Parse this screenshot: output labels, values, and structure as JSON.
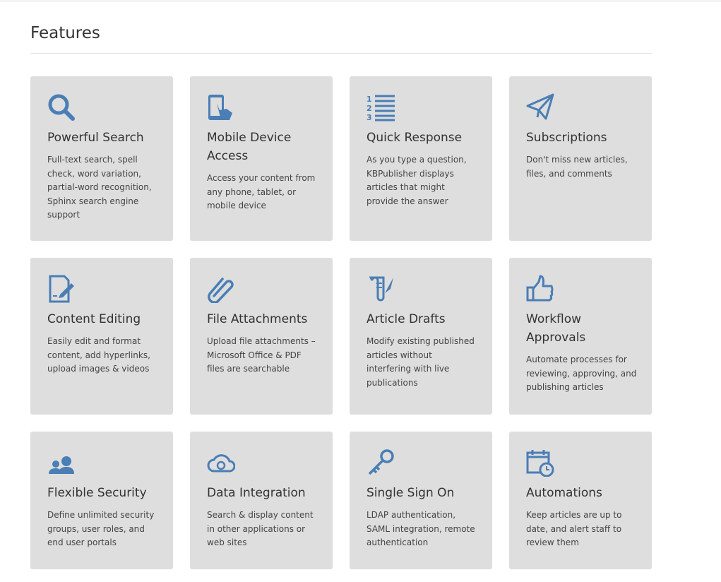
{
  "page": {
    "title": "Features",
    "accent": "#4a7eb5"
  },
  "features": [
    {
      "icon": "search-icon",
      "title": "Powerful Search",
      "desc": "Full-text search, spell check, word variation, partial-word recognition, Sphinx search engine support"
    },
    {
      "icon": "mobile-touch-icon",
      "title": "Mobile Device Access",
      "desc": "Access your content from any phone, tablet, or mobile device"
    },
    {
      "icon": "numbered-list-icon",
      "title": "Quick Response",
      "desc": "As you type a question, KBPublisher displays articles that might provide the answer"
    },
    {
      "icon": "paper-plane-icon",
      "title": "Subscriptions",
      "desc": "Don't miss new articles, files, and comments"
    },
    {
      "icon": "edit-document-icon",
      "title": "Content Editing",
      "desc": "Easily edit and format content, add hyperlinks, upload images & videos"
    },
    {
      "icon": "paperclip-icon",
      "title": "File Attachments",
      "desc": "Upload file attachments – Microsoft Office & PDF files are searchable"
    },
    {
      "icon": "scroll-quill-icon",
      "title": "Article Drafts",
      "desc": "Modify existing published articles without interfering with live publications"
    },
    {
      "icon": "thumbs-up-icon",
      "title": "Workflow Approvals",
      "desc": "Automate processes for reviewing, approving, and publishing articles"
    },
    {
      "icon": "users-icon",
      "title": "Flexible Security",
      "desc": "Define unlimited security groups, user roles, and end user portals"
    },
    {
      "icon": "cloud-sync-icon",
      "title": "Data Integration",
      "desc": "Search & display content in other applications or web sites"
    },
    {
      "icon": "key-icon",
      "title": "Single Sign On",
      "desc": "LDAP authentication, SAML integration, remote authentication"
    },
    {
      "icon": "calendar-clock-icon",
      "title": "Automations",
      "desc": "Keep articles are up to date, and alert staff to review them"
    }
  ]
}
